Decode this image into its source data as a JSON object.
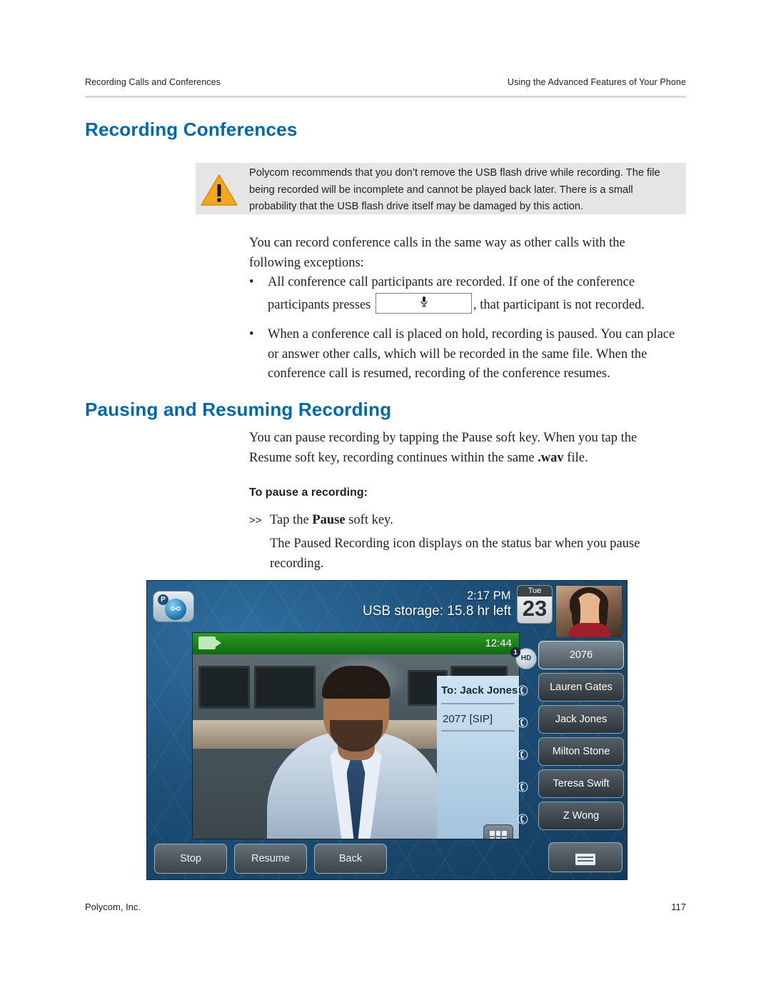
{
  "header": {
    "left": "Recording Calls and Conferences",
    "right": "Using the Advanced Features of Your Phone"
  },
  "sections": {
    "recording_conferences": {
      "heading": "Recording Conferences",
      "warning": "Polycom recommends that you don’t remove the USB flash drive while recording. The file being recorded will be incomplete and cannot be played back later. There is a small probability that the USB flash drive itself may be damaged by this action.",
      "intro": "You can record conference calls in the same way as other calls with the following exceptions:",
      "bullet1_before": "All conference call participants are recorded. If one of the conference participants presses",
      "bullet1_after": ", that participant is not recorded.",
      "bullet1_key_icon": "microphone-mute-icon",
      "bullet2": "When a conference call is placed on hold, recording is paused. You can place or answer other calls, which will be recorded in the same file. When the conference call is resumed, recording of the conference resumes."
    },
    "pausing_resuming": {
      "heading": "Pausing and Resuming Recording",
      "intro_part1": "You can pause recording by tapping the Pause soft key. When you tap the Resume soft key, recording continues within the same ",
      "intro_bold": ".wav",
      "intro_part2": " file.",
      "subhead": "To pause a recording:",
      "step_marker": ">>",
      "step_text_before": "Tap the ",
      "step_text_bold": "Pause",
      "step_text_after": " soft key.",
      "note": "The Paused Recording icon displays on the status bar when you pause recording."
    }
  },
  "phone": {
    "status": {
      "usb_storage": "USB storage: 15.8 hr left",
      "time": "2:17 PM",
      "day_of_week": "Tue",
      "day_number": "23",
      "badge_letter": "P"
    },
    "video": {
      "call_timer": "12:44",
      "callee_label": "To: Jack Jones",
      "callee_number": "2077 [SIP]"
    },
    "roster": [
      {
        "label": "2076",
        "icon": "hd-audio-badge",
        "badge_number": "1",
        "badge_text": "HD",
        "active": true
      },
      {
        "label": "Lauren Gates",
        "icon": "handset-icon",
        "active": false
      },
      {
        "label": "Jack Jones",
        "icon": "handset-icon",
        "active": false
      },
      {
        "label": "Milton Stone",
        "icon": "handset-icon",
        "active": false
      },
      {
        "label": "Teresa Swift",
        "icon": "handset-icon",
        "active": false
      },
      {
        "label": "Z Wong",
        "icon": "handset-icon",
        "active": false
      }
    ],
    "softkeys": [
      "Stop",
      "Resume",
      "Back"
    ],
    "menu_key_icon": "menu-icon"
  },
  "footer": {
    "left": "Polycom, Inc.",
    "right": "117"
  },
  "colors": {
    "heading_blue": "#0069aa",
    "warning_bg": "#e5e5e5",
    "rule_gray": "#d9d9d9",
    "recording_green": "#2f9a27"
  }
}
